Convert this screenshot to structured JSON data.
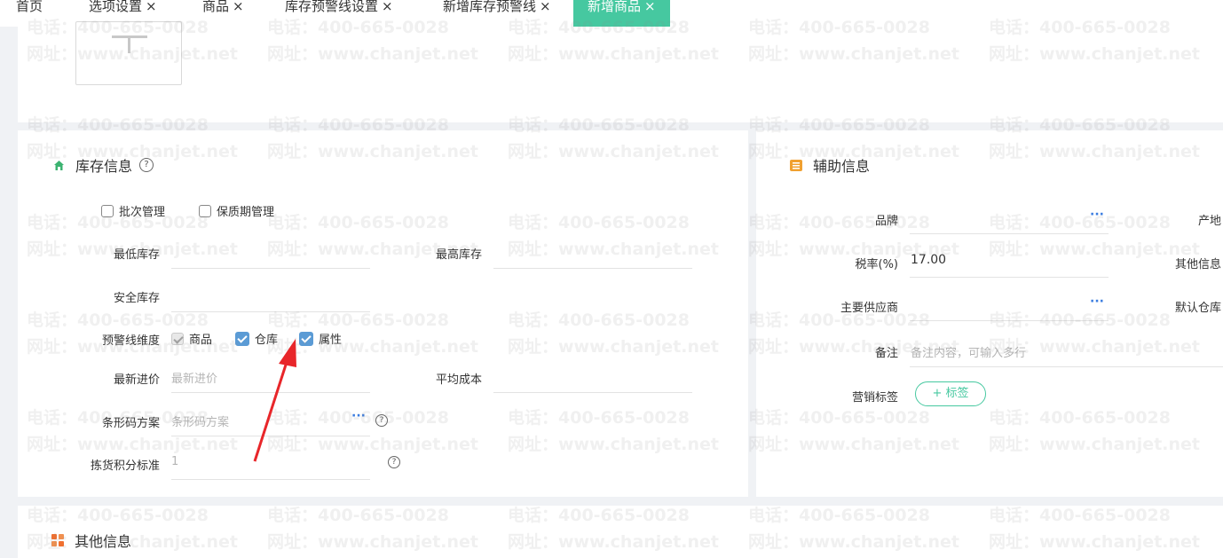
{
  "tabs": [
    {
      "label": "首页",
      "closable": false,
      "active": false
    },
    {
      "label": "选项设置",
      "closable": true,
      "active": false
    },
    {
      "label": "商品",
      "closable": true,
      "active": false
    },
    {
      "label": "库存预警线设置",
      "closable": true,
      "active": false
    },
    {
      "label": "新增库存预警线",
      "closable": true,
      "active": false
    },
    {
      "label": "新增商品",
      "closable": true,
      "active": true
    }
  ],
  "close_glyph": "×",
  "inventory": {
    "title": "库存信息",
    "checkboxes": {
      "batch": {
        "label": "批次管理",
        "checked": false
      },
      "shelf_life": {
        "label": "保质期管理",
        "checked": false
      }
    },
    "min_stock": {
      "label": "最低库存",
      "value": ""
    },
    "max_stock": {
      "label": "最高库存",
      "value": ""
    },
    "safety_stock": {
      "label": "安全库存",
      "value": ""
    },
    "warning_dim": {
      "label": "预警线维度",
      "options": [
        {
          "label": "商品",
          "checked": true,
          "disabled": true
        },
        {
          "label": "仓库",
          "checked": true,
          "disabled": false
        },
        {
          "label": "属性",
          "checked": true,
          "disabled": false
        }
      ]
    },
    "latest_price": {
      "label": "最新进价",
      "placeholder": "最新进价"
    },
    "avg_cost": {
      "label": "平均成本",
      "value": ""
    },
    "barcode": {
      "label": "条形码方案",
      "placeholder": "条形码方案",
      "more": "···"
    },
    "picking": {
      "label": "拣货积分标准",
      "placeholder": "1"
    }
  },
  "auxiliary": {
    "title": "辅助信息",
    "brand": {
      "label": "品牌",
      "more": "···"
    },
    "origin": {
      "label": "产地"
    },
    "tax_rate": {
      "label": "税率(%)",
      "value": "17.00"
    },
    "other_info": {
      "label": "其他信息"
    },
    "supplier": {
      "label": "主要供应商",
      "more": "···"
    },
    "default_warehouse": {
      "label": "默认仓库"
    },
    "remark": {
      "label": "备注",
      "placeholder": "备注内容，可输入多行"
    },
    "marketing_tag": {
      "label": "营销标签",
      "button": "+ 标签"
    }
  },
  "other": {
    "title": "其他信息"
  },
  "watermark": {
    "phone": "电话：400-665-0028",
    "site": "网址：www.chanjet.net"
  },
  "colors": {
    "accent": "#46c8a0",
    "checkbox": "#5b9bd5",
    "arrow": "#e8262a",
    "link": "#3b7de0"
  },
  "icons": {
    "inventory": "house-icon",
    "auxiliary": "list-icon",
    "other": "grid-icon",
    "help": "question-icon"
  }
}
